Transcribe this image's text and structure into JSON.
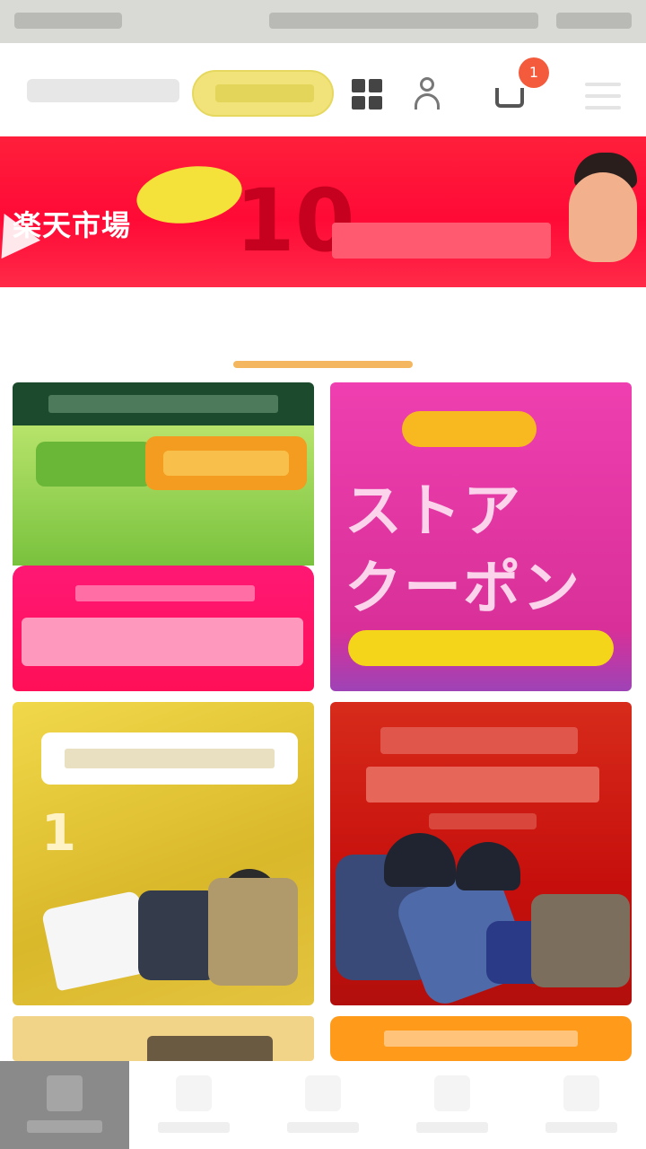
{
  "header": {
    "cart_count": "1",
    "icons": [
      "grid-icon",
      "person-icon",
      "cart-icon",
      "menu-icon"
    ]
  },
  "banner": {
    "title": "楽天市場",
    "badge": "",
    "big_number": "10",
    "small_text": "",
    "right_text": "",
    "right_sub": ""
  },
  "tabs": [
    {
      "label": ""
    },
    {
      "label": ""
    },
    {
      "label": ""
    }
  ],
  "cards": [
    {
      "title": ""
    },
    {
      "title_line1": "ストア",
      "title_line2": "クーポン"
    },
    {
      "big_text": "1"
    },
    {
      "title": ""
    }
  ],
  "colors": {
    "accent_orange": "#f6a13f",
    "banner_red": "#ff0a36",
    "search_yellow": "#f1e37a"
  }
}
